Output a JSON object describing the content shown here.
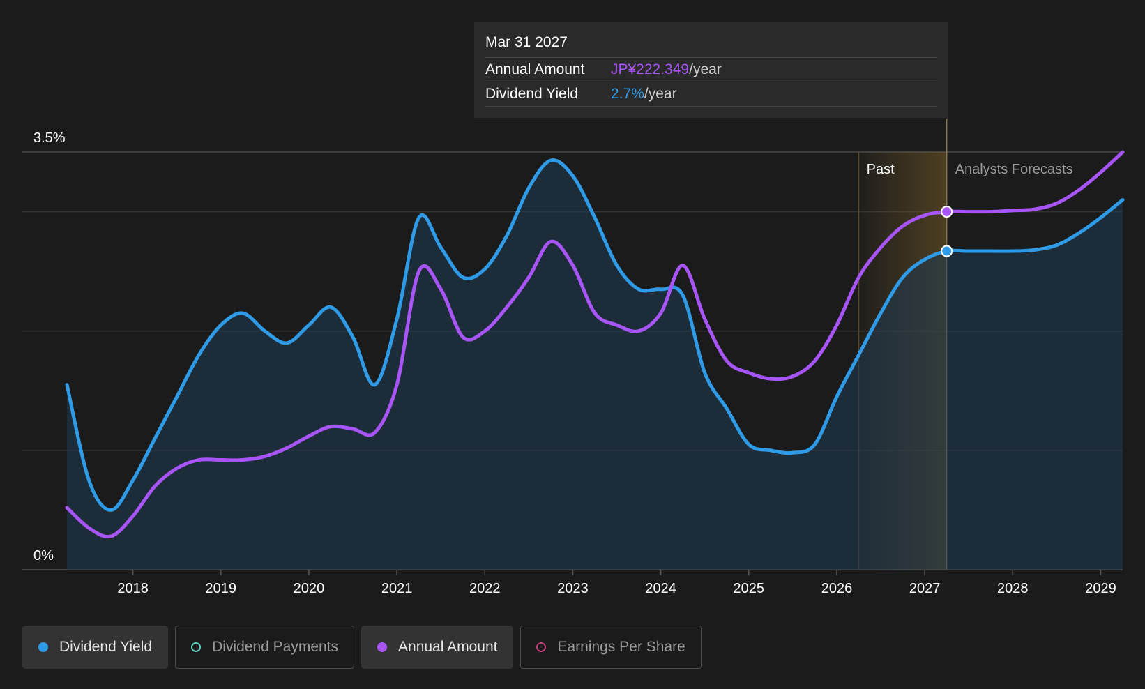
{
  "tooltip": {
    "date": "Mar 31 2027",
    "annual_label": "Annual Amount",
    "annual_value": "JP¥222.349",
    "annual_unit": "/year",
    "yield_label": "Dividend Yield",
    "yield_value": "2.7%",
    "yield_unit": "/year"
  },
  "legend": [
    {
      "label": "Dividend Yield",
      "active": true,
      "color": "#2f9ae6",
      "style": "filled"
    },
    {
      "label": "Dividend Payments",
      "active": false,
      "color": "#5fd0c0",
      "style": "ring"
    },
    {
      "label": "Annual Amount",
      "active": true,
      "color": "#a855f7",
      "style": "filled"
    },
    {
      "label": "Earnings Per Share",
      "active": false,
      "color": "#c23b7a",
      "style": "ring"
    }
  ],
  "chart_data": {
    "type": "line",
    "ylim": [
      0,
      3.5
    ],
    "yticks": [
      {
        "value": 3.5,
        "label": "3.5%"
      },
      {
        "value": 0,
        "label": "0%"
      }
    ],
    "xlim": [
      2017.25,
      2029.25
    ],
    "xticks": [
      "2018",
      "2019",
      "2020",
      "2021",
      "2022",
      "2023",
      "2024",
      "2025",
      "2026",
      "2027",
      "2028",
      "2029"
    ],
    "past_label": "Past",
    "forecast_label": "Analysts Forecasts",
    "past_region_start": 2026.25,
    "forecast_start": 2027.25,
    "grid": true,
    "series": [
      {
        "name": "Dividend Yield",
        "color": "#2f9ae6",
        "area": true,
        "points": [
          [
            2017.25,
            1.55
          ],
          [
            2017.5,
            0.75
          ],
          [
            2017.75,
            0.5
          ],
          [
            2018.0,
            0.75
          ],
          [
            2018.25,
            1.1
          ],
          [
            2018.5,
            1.45
          ],
          [
            2018.75,
            1.8
          ],
          [
            2019.0,
            2.05
          ],
          [
            2019.25,
            2.15
          ],
          [
            2019.5,
            2.0
          ],
          [
            2019.75,
            1.9
          ],
          [
            2020.0,
            2.05
          ],
          [
            2020.25,
            2.2
          ],
          [
            2020.5,
            1.95
          ],
          [
            2020.75,
            1.55
          ],
          [
            2021.0,
            2.1
          ],
          [
            2021.25,
            2.95
          ],
          [
            2021.5,
            2.7
          ],
          [
            2021.75,
            2.45
          ],
          [
            2022.0,
            2.52
          ],
          [
            2022.25,
            2.8
          ],
          [
            2022.5,
            3.2
          ],
          [
            2022.75,
            3.43
          ],
          [
            2023.0,
            3.3
          ],
          [
            2023.25,
            2.95
          ],
          [
            2023.5,
            2.55
          ],
          [
            2023.75,
            2.35
          ],
          [
            2024.0,
            2.35
          ],
          [
            2024.25,
            2.3
          ],
          [
            2024.5,
            1.65
          ],
          [
            2024.75,
            1.35
          ],
          [
            2025.0,
            1.05
          ],
          [
            2025.25,
            1.0
          ],
          [
            2025.5,
            0.98
          ],
          [
            2025.75,
            1.05
          ],
          [
            2026.0,
            1.45
          ],
          [
            2026.25,
            1.8
          ],
          [
            2026.5,
            2.15
          ],
          [
            2026.75,
            2.45
          ],
          [
            2027.0,
            2.6
          ],
          [
            2027.25,
            2.67
          ],
          [
            2027.5,
            2.67
          ],
          [
            2027.75,
            2.67
          ],
          [
            2028.0,
            2.67
          ],
          [
            2028.25,
            2.68
          ],
          [
            2028.5,
            2.72
          ],
          [
            2028.75,
            2.82
          ],
          [
            2029.0,
            2.95
          ],
          [
            2029.25,
            3.1
          ]
        ]
      },
      {
        "name": "Annual Amount",
        "color": "#a855f7",
        "area": false,
        "points": [
          [
            2017.25,
            0.52
          ],
          [
            2017.5,
            0.35
          ],
          [
            2017.75,
            0.28
          ],
          [
            2018.0,
            0.45
          ],
          [
            2018.25,
            0.7
          ],
          [
            2018.5,
            0.85
          ],
          [
            2018.75,
            0.92
          ],
          [
            2019.0,
            0.92
          ],
          [
            2019.25,
            0.92
          ],
          [
            2019.5,
            0.95
          ],
          [
            2019.75,
            1.02
          ],
          [
            2020.0,
            1.12
          ],
          [
            2020.25,
            1.2
          ],
          [
            2020.5,
            1.18
          ],
          [
            2020.75,
            1.15
          ],
          [
            2021.0,
            1.55
          ],
          [
            2021.25,
            2.5
          ],
          [
            2021.5,
            2.35
          ],
          [
            2021.75,
            1.95
          ],
          [
            2022.0,
            2.0
          ],
          [
            2022.25,
            2.2
          ],
          [
            2022.5,
            2.45
          ],
          [
            2022.75,
            2.75
          ],
          [
            2023.0,
            2.55
          ],
          [
            2023.25,
            2.15
          ],
          [
            2023.5,
            2.05
          ],
          [
            2023.75,
            2.0
          ],
          [
            2024.0,
            2.15
          ],
          [
            2024.25,
            2.55
          ],
          [
            2024.5,
            2.1
          ],
          [
            2024.75,
            1.75
          ],
          [
            2025.0,
            1.65
          ],
          [
            2025.25,
            1.6
          ],
          [
            2025.5,
            1.62
          ],
          [
            2025.75,
            1.75
          ],
          [
            2026.0,
            2.05
          ],
          [
            2026.25,
            2.45
          ],
          [
            2026.5,
            2.7
          ],
          [
            2026.75,
            2.88
          ],
          [
            2027.0,
            2.97
          ],
          [
            2027.25,
            3.0
          ],
          [
            2027.5,
            3.0
          ],
          [
            2027.75,
            3.0
          ],
          [
            2028.0,
            3.01
          ],
          [
            2028.25,
            3.02
          ],
          [
            2028.5,
            3.07
          ],
          [
            2028.75,
            3.18
          ],
          [
            2029.0,
            3.33
          ],
          [
            2029.25,
            3.5
          ]
        ]
      }
    ],
    "highlight_x": 2027.25,
    "highlight_values": {
      "Dividend Yield": 2.67,
      "Annual Amount": 3.0
    }
  }
}
